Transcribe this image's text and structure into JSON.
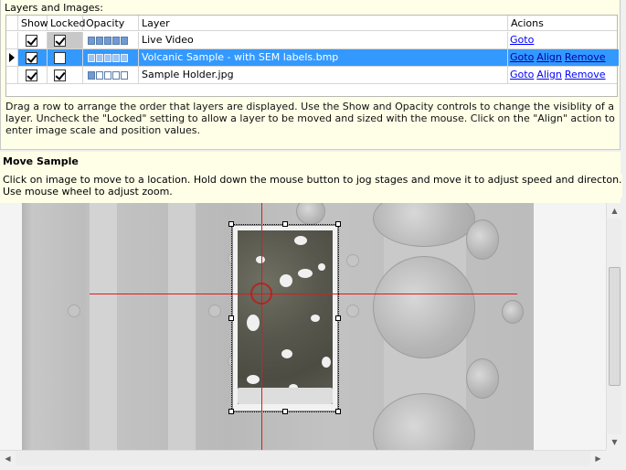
{
  "layers_panel": {
    "title": "Layers and Images:",
    "columns": {
      "show": "Show",
      "locked": "Locked",
      "opacity": "Opacity",
      "layer": "Layer",
      "actions": "Acions"
    },
    "rows": [
      {
        "show": true,
        "locked": true,
        "opacity_level": 5,
        "name": "Live Video",
        "actions": [
          "Goto"
        ],
        "selected": false
      },
      {
        "show": true,
        "locked": false,
        "opacity_level": 5,
        "name": "Volcanic Sample - with SEM labels.bmp",
        "actions": [
          "Goto",
          "Align",
          "Remove"
        ],
        "selected": true
      },
      {
        "show": true,
        "locked": true,
        "opacity_level": 1,
        "name": "Sample Holder.jpg",
        "actions": [
          "Goto",
          "Align",
          "Remove"
        ],
        "selected": false
      }
    ],
    "help_text": "Drag a row to arrange the order that layers are displayed. Use the Show and Opacity controls to change the visiblity of a layer. Uncheck the \"Locked\" setting to allow a layer to be moved and sized with the mouse. Click on the \"Align\" action to enter image scale and position values."
  },
  "move_sample": {
    "title": "Move Sample",
    "help_text": "Click on image to move to a location. Hold down the mouse button to jog stages and move it to adjust speed and directon. Use mouse wheel to adjust zoom."
  },
  "colors": {
    "selection": "#3399ff",
    "crosshair": "#e01a1a",
    "panel_bg": "#ffffe8",
    "link": "#0000ff"
  },
  "icons": {
    "row_pointer": "triangle-right-icon",
    "scroll_up": "arrow-up-icon",
    "scroll_down": "arrow-down-icon",
    "scroll_left": "arrow-left-icon",
    "scroll_right": "arrow-right-icon"
  }
}
